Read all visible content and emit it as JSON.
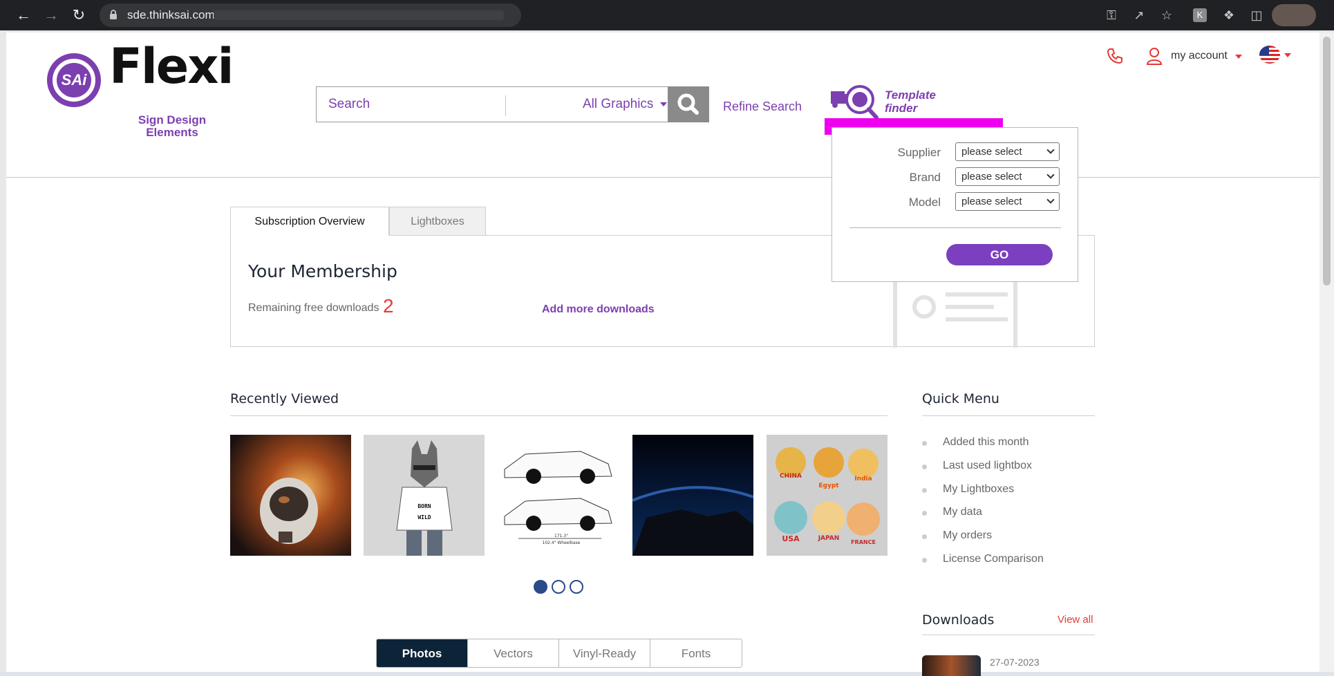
{
  "browser": {
    "url": "sde.thinksai.com"
  },
  "header": {
    "logo_text": "Flexi",
    "logo_badge": "SAi",
    "logo_subtitle_line1": "Sign Design",
    "logo_subtitle_line2": "Elements",
    "search": {
      "placeholder": "Search",
      "category": "All Graphics"
    },
    "refine_search": "Refine Search",
    "template_finder": {
      "label_line1": "Template",
      "label_line2": "finder"
    },
    "account_label": "my account",
    "colors": {
      "brand_purple": "#7c3fb0",
      "accent_red": "#e53935",
      "highlight_magenta": "#ee00ee"
    }
  },
  "template_finder_panel": {
    "fields": [
      {
        "label": "Supplier",
        "value": "please select"
      },
      {
        "label": "Brand",
        "value": "please select"
      },
      {
        "label": "Model",
        "value": "please select"
      }
    ],
    "go_label": "GO"
  },
  "tabs": [
    {
      "label": "Subscription Overview",
      "active": true
    },
    {
      "label": "Lightboxes",
      "active": false
    }
  ],
  "membership": {
    "title": "Your Membership",
    "remaining_label": "Remaining free downloads",
    "remaining_count": "2",
    "add_more": "Add more downloads"
  },
  "recently_viewed": {
    "title": "Recently Viewed",
    "thumbnails": [
      {
        "name": "astronaut-photo"
      },
      {
        "name": "wolf-born-wild-illustration",
        "caption": "BORN WILD"
      },
      {
        "name": "vehicle-template-drawing",
        "text_1": "171.3\"",
        "text_2": "102.4\" Wheelbase"
      },
      {
        "name": "earth-at-night-photo"
      },
      {
        "name": "country-stickers",
        "labels": [
          "CHINA",
          "Egypt",
          "India",
          "USA",
          "JAPAN",
          "FRANCE"
        ]
      }
    ],
    "pager_pages": 3,
    "pager_current": 1
  },
  "media_tabs": [
    {
      "label": "Photos",
      "active": true
    },
    {
      "label": "Vectors",
      "active": false
    },
    {
      "label": "Vinyl-Ready",
      "active": false
    },
    {
      "label": "Fonts",
      "active": false
    }
  ],
  "quick_menu": {
    "title": "Quick Menu",
    "items": [
      "Added this month",
      "Last used lightbox",
      "My Lightboxes",
      "My data",
      "My orders",
      "License Comparison"
    ]
  },
  "downloads": {
    "title": "Downloads",
    "view_all": "View all",
    "first_date": "27-07-2023"
  }
}
